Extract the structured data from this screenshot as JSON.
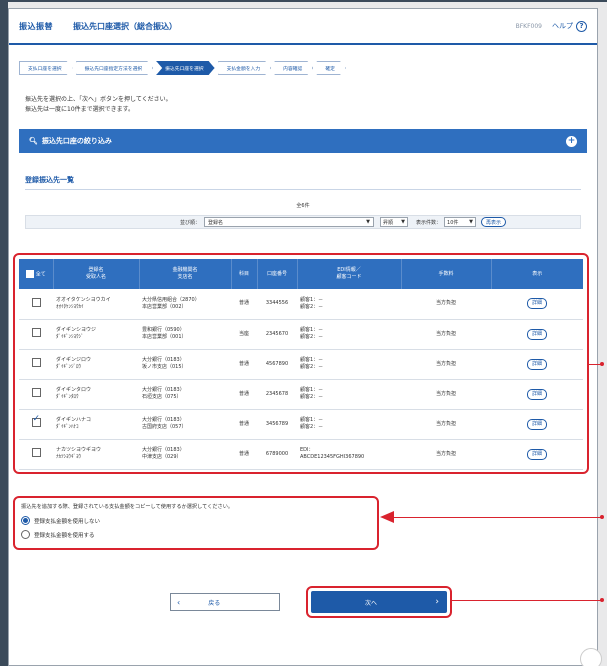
{
  "header": {
    "logo": "振込振替",
    "title": "振込先口座選択（総合振込）",
    "screen_id": "BFKF009",
    "help_label": "ヘルプ"
  },
  "steps": [
    {
      "label": "支払口座を選択",
      "active": false
    },
    {
      "label": "振込先口座指定方法を選択",
      "active": false
    },
    {
      "label": "振込先口座を選択",
      "active": true
    },
    {
      "label": "支払金額を入力",
      "active": false
    },
    {
      "label": "内容確認",
      "active": false
    },
    {
      "label": "確定",
      "active": false
    }
  ],
  "instructions": {
    "line1": "振込先を選択の上、「次へ」ボタンを押してください。",
    "line2": "振込先は一度に10件まで選択できます。"
  },
  "filter": {
    "label": "振込先口座の絞り込み"
  },
  "list": {
    "title": "登録振込先一覧",
    "count": "全6件",
    "sort_label": "並び順：",
    "sort_value": "登録名",
    "order_value": "昇順",
    "per_page_label": "表示件数：",
    "per_page_value": "10件",
    "redisplay_label": "再表示"
  },
  "table": {
    "headers": {
      "all": "全て",
      "name1": "登録名",
      "name2": "受取人名",
      "bank1": "金融機関名",
      "bank2": "支店名",
      "type": "科目",
      "account": "口座番号",
      "edi1": "EDI情報／",
      "edi2": "顧客コード",
      "fee": "手数料",
      "show": "表示"
    },
    "rows": [
      {
        "checked": false,
        "name": "オオイタケンシヨウカイ",
        "kana": "ｵｵｲﾀｹﾝｼﾖｳｶｲ",
        "bank": "大分県信用組合（2870）",
        "branch": "本店営業部（002）",
        "type": "普通",
        "account": "3344556",
        "edi1": "顧客1：－",
        "edi2": "顧客2：－",
        "fee": "当方負担",
        "detail": "詳細"
      },
      {
        "checked": false,
        "name": "ダイギンシヨウジ",
        "kana": "ﾀﾞｲｷﾞﾝｼﾖｳｼﾞ",
        "bank": "豊和銀行（0590）",
        "branch": "本店営業部（001）",
        "type": "当座",
        "account": "2345670",
        "edi1": "顧客1：－",
        "edi2": "顧客2：－",
        "fee": "当方負担",
        "detail": "詳細"
      },
      {
        "checked": false,
        "name": "ダイギンジロウ",
        "kana": "ﾀﾞｲｷﾞﾝｼﾞﾛｳ",
        "bank": "大分銀行（0183）",
        "branch": "坂ノ市支店（015）",
        "type": "普通",
        "account": "4567890",
        "edi1": "顧客1：－",
        "edi2": "顧客2：－",
        "fee": "当方負担",
        "detail": "詳細"
      },
      {
        "checked": false,
        "name": "ダイギンタロウ",
        "kana": "ﾀﾞｲｷﾞﾝﾀﾛｳ",
        "bank": "大分銀行（0183）",
        "branch": "石垣支店（075）",
        "type": "普通",
        "account": "2345678",
        "edi1": "顧客1：－",
        "edi2": "顧客2：－",
        "fee": "当方負担",
        "detail": "詳細"
      },
      {
        "checked": true,
        "name": "ダイギンハナコ",
        "kana": "ﾀﾞｲｷﾞﾝﾊﾅｺ",
        "bank": "大分銀行（0183）",
        "branch": "古国府支店（057）",
        "type": "普通",
        "account": "3456789",
        "edi1": "顧客1：－",
        "edi2": "顧客2：－",
        "fee": "当方負担",
        "detail": "詳細"
      },
      {
        "checked": false,
        "name": "ナカツシヨウギヨウ",
        "kana": "ﾅｶﾂｼﾖｳｷﾞﾖｳ",
        "bank": "大分銀行（0183）",
        "branch": "中津支店（029）",
        "type": "普通",
        "account": "6789000",
        "edi1": "EDI：",
        "edi2": "ABCDE12345FGHI367890",
        "fee": "当方負担",
        "detail": "詳細"
      }
    ]
  },
  "options": {
    "text": "振込先を追加する際、登録されている支払金額をコピーして使用するか選択してください。",
    "radio1": "登録支払金額を使用しない",
    "radio2": "登録支払金額を使用する",
    "selected": 1
  },
  "buttons": {
    "back": "戻る",
    "next": "次へ"
  },
  "colors": {
    "brand": "#1e5aa8",
    "highlight": "#d9232e"
  }
}
